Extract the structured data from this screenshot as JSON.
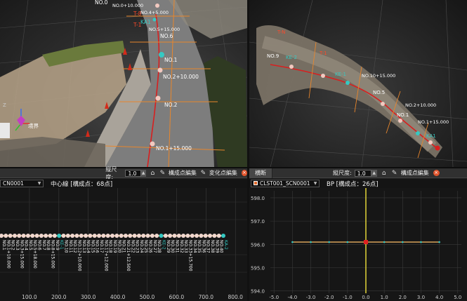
{
  "colors": {
    "accent_orange": "#e8862c",
    "station_cyan": "#35c9c3",
    "road_line_red": "#d81f1f",
    "axis_yellow": "#f0e23a",
    "profile_line": "#d8a45a"
  },
  "top_left_view": {
    "labels": [
      "NO.1",
      "NO.2",
      "NO.2+10.000",
      "NO.1+15.000",
      "NO.0",
      "NO.6",
      "KA1",
      "T-1",
      "T-8",
      "境界"
    ],
    "station_labels_small": [
      "NO.0+10.000",
      "NO.4+5.000",
      "NO.5+15.000"
    ]
  },
  "top_right_view": {
    "labels": [
      "T-N",
      "NO.9",
      "KE-2",
      "KE-1",
      "T-1",
      "NO.10+15.000",
      "NO.2+10.000",
      "NO.1+15.000",
      "NO.5",
      "KA1",
      "NO.1"
    ]
  },
  "bottom_left": {
    "toolbar": {
      "scale_label": "縦尺度:",
      "scale_value": "1.0",
      "point_edit_label": "構成点編集",
      "change_point_edit_label": "変化点編集"
    },
    "selector_value": "CN0001",
    "title": "中心線 [構成点：68点]"
  },
  "bottom_right": {
    "toolbar": {
      "tab_label": "横断",
      "scale_label": "縦尺度:",
      "scale_value": "1.0",
      "point_edit_label": "構成点編集"
    },
    "selector_value": "CLST001_SCN0001",
    "title": "BP [構成点：26点]"
  },
  "chart_data": [
    {
      "type": "line",
      "title": "中心線 [構成点：68点]",
      "x_ticks": [
        "100.0",
        "200.0",
        "300.0",
        "400.0",
        "500.0",
        "600.0",
        "700.0",
        "800.0"
      ],
      "xlim": [
        0,
        840
      ],
      "point_labels": [
        "NO.1",
        "NO.1+10.000",
        "NO.2",
        "NO.3",
        "NO.3+15.000",
        "NO.4",
        "NO.5",
        "NO.5+18.000",
        "NO.6",
        "NO.7",
        "NO.8",
        "NO.8+15.000",
        "NO.9",
        "KE-1",
        "NO.10",
        "NO.11",
        "NO.12",
        "NO.12+10.000",
        "NO.13",
        "NO.14",
        "NO.15",
        "NO.16",
        "NO.17",
        "NO.17+12.000",
        "NO.18",
        "NO.19",
        "NO.20",
        "NO.21",
        "NO.21+12.500",
        "NO.22",
        "NO.23",
        "NO.24",
        "NO.25",
        "NO.26",
        "NO.27",
        "NO.28",
        "KE-2",
        "NO.29",
        "NO.30",
        "NO.31",
        "NO.32",
        "NO.33",
        "NO.33+15.700",
        "NO.34",
        "NO.35",
        "NO.36",
        "NO.37",
        "NO.38",
        "NO.39",
        "NO.40",
        "KA-2"
      ],
      "grid": true
    },
    {
      "type": "line",
      "title": "BP [構成点：26点]",
      "x_ticks": [
        "-5.0",
        "-4.0",
        "-3.0",
        "-2.0",
        "-1.0",
        "0.0",
        "1.0",
        "2.0",
        "3.0",
        "4.0",
        "5.0"
      ],
      "y_ticks": [
        "598.0",
        "597.0",
        "596.0",
        "595.0",
        "594.0"
      ],
      "xlim": [
        -5.2,
        5.2
      ],
      "ylim": [
        593.9,
        598.3
      ],
      "series": [
        {
          "values_x": [
            -4.0,
            -3.0,
            -2.0,
            -1.0,
            0.0,
            1.0,
            2.0,
            3.0,
            4.0
          ],
          "values_y": [
            596.1,
            596.1,
            596.1,
            596.1,
            596.1,
            596.1,
            596.1,
            596.1,
            596.1
          ]
        }
      ],
      "center_point": {
        "x": 0.0,
        "y": 596.1
      },
      "grid": true
    }
  ]
}
